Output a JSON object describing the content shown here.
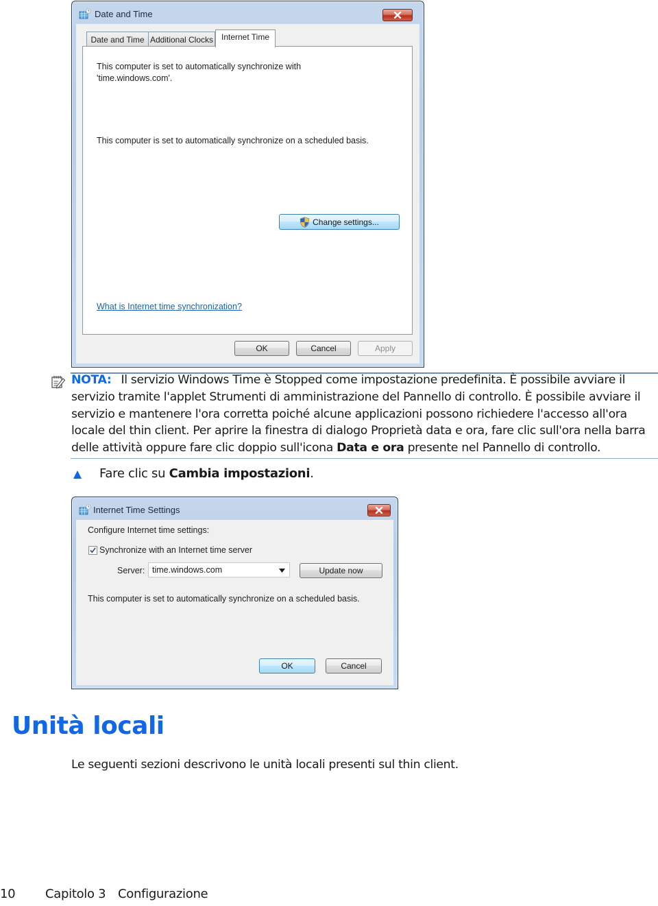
{
  "dialog_date_time": {
    "title": "Date and Time",
    "title_icon": "calendar-clock-icon",
    "close_icon": "close-icon",
    "tabs": [
      {
        "label": "Date and Time",
        "active": false
      },
      {
        "label": "Additional Clocks",
        "active": false
      },
      {
        "label": "Internet Time",
        "active": true
      }
    ],
    "sync_status_line1": "This computer is set to automatically synchronize with",
    "sync_status_line2": "'time.windows.com'.",
    "schedule_text": "This computer is set to automatically synchronize on a scheduled basis.",
    "change_settings_label": "Change settings...",
    "change_settings_icon": "uac-shield-icon",
    "help_link": "What is Internet time synchronization?",
    "buttons": {
      "ok": "OK",
      "cancel": "Cancel",
      "apply": "Apply"
    }
  },
  "note": {
    "icon": "note-pencil-icon",
    "label": "NOTA:",
    "text_part1": "Il servizio Windows Time è Stopped come impostazione predefinita. È possibile avviare il servizio tramite l'applet Strumenti di amministrazione del Pannello di controllo. È possibile avviare il servizio e mantenere l'ora corretta poiché alcune applicazioni possono richiedere l'accesso all'ora locale del thin client. Per aprire la finestra di dialogo Proprietà data e ora, fare clic sull'ora nella barra delle attività oppure fare clic doppio sull'icona ",
    "text_bold": "Data e ora",
    "text_part2": " presente nel Pannello di controllo."
  },
  "step": {
    "icon": "triangle-bullet-icon",
    "text_prefix": "Fare clic su ",
    "text_bold": "Cambia impostazioni",
    "text_suffix": "."
  },
  "dialog_internet_time": {
    "title": "Internet Time Settings",
    "title_icon": "calendar-clock-icon",
    "close_icon": "close-icon",
    "heading": "Configure Internet time settings:",
    "sync_checkbox_label": "Synchronize with an Internet time server",
    "sync_checkbox_checked": true,
    "server_label": "Server:",
    "server_value": "time.windows.com",
    "update_now_label": "Update now",
    "schedule_text": "This computer is set to automatically synchronize on a scheduled basis.",
    "buttons": {
      "ok": "OK",
      "cancel": "Cancel"
    }
  },
  "section": {
    "title": "Unità locali",
    "body": "Le seguenti sezioni descrivono le unità locali presenti sul thin client."
  },
  "footer": {
    "page_number": "10",
    "chapter": "Capitolo 3",
    "chapter_title": "Configurazione"
  },
  "colors": {
    "accent_blue": "#1267e6",
    "link_blue": "#2163a8",
    "note_rule": "#6e8eb3"
  }
}
